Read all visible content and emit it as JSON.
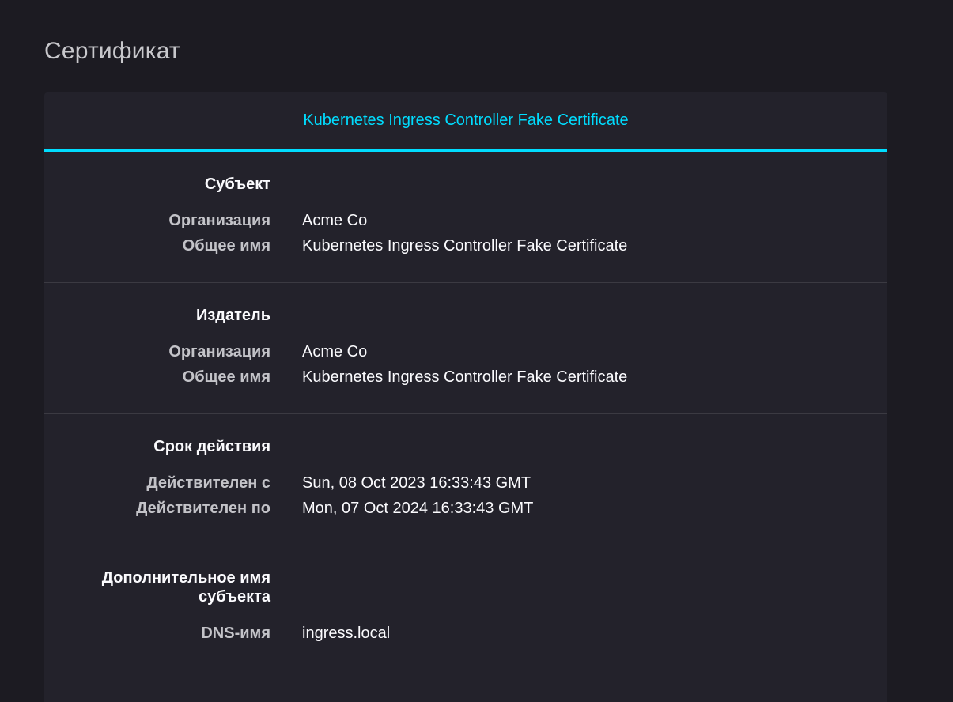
{
  "page_title": "Сертификат",
  "tab": {
    "label": "Kubernetes Ingress Controller Fake Certificate",
    "accent_color": "#00ddff"
  },
  "sections": [
    {
      "title": "Субъект",
      "fields": [
        {
          "label": "Организация",
          "value": "Acme Co"
        },
        {
          "label": "Общее имя",
          "value": "Kubernetes Ingress Controller Fake Certificate"
        }
      ]
    },
    {
      "title": "Издатель",
      "fields": [
        {
          "label": "Организация",
          "value": "Acme Co"
        },
        {
          "label": "Общее имя",
          "value": "Kubernetes Ingress Controller Fake Certificate"
        }
      ]
    },
    {
      "title": "Срок действия",
      "fields": [
        {
          "label": "Действителен с",
          "value": "Sun, 08 Oct 2023 16:33:43 GMT"
        },
        {
          "label": "Действителен по",
          "value": "Mon, 07 Oct 2024 16:33:43 GMT"
        }
      ]
    },
    {
      "title_line1": "Дополнительное имя",
      "title_line2": "субъекта",
      "fields": [
        {
          "label": "DNS-имя",
          "value": "ingress.local"
        }
      ]
    }
  ]
}
